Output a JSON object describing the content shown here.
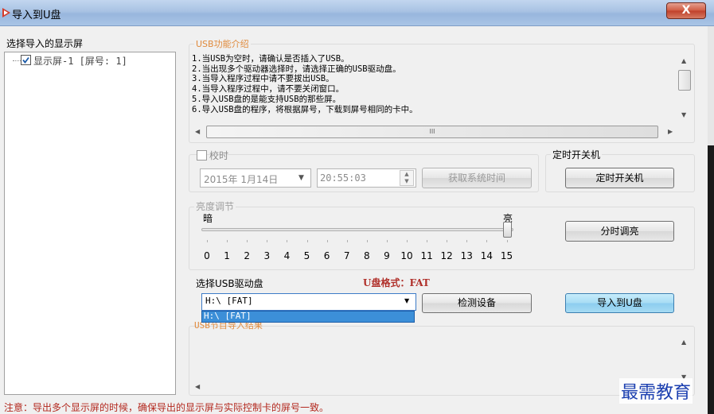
{
  "window": {
    "title": "导入到U盘",
    "close_glyph": "X"
  },
  "left_panel": {
    "caption": "选择导入的显示屏",
    "tree_items": [
      "显示屏-1 [屏号: 1]"
    ],
    "tree_item_checked": true
  },
  "usb_info": {
    "group_title": "USB功能介绍",
    "lines": [
      "1.当USB为空时，请确认是否插入了USB。",
      "2.当出现多个驱动器选择时，请选择正确的USB驱动盘。",
      "3.当导入程序过程中请不要拔出USB。",
      "4.当导入程序过程中，请不要关闭窗口。",
      "5.导入USB盘的是能支持USB的那些屏。",
      "6.导入USB盘的程序，将根据屏号，下载到屏号相同的卡中。"
    ],
    "scroll_thumb_glyph": "III"
  },
  "clock": {
    "checkbox_label": "校时",
    "checked": false,
    "date_value": "2015年 1月14日",
    "time_value": "20:55:03",
    "get_time_button": "获取系统时间"
  },
  "timer": {
    "group_title": "定时开关机",
    "button": "定时开关机"
  },
  "brightness": {
    "group_title": "亮度调节",
    "dark_label": "暗",
    "bright_label": "亮",
    "scale": [
      "0",
      "1",
      "2",
      "3",
      "4",
      "5",
      "6",
      "7",
      "8",
      "9",
      "10",
      "11",
      "12",
      "13",
      "14",
      "15"
    ],
    "value": 15,
    "timed_button": "分时调亮"
  },
  "drive": {
    "caption": "选择USB驱动盘",
    "format_label": "U盘格式：FAT",
    "selected": "H:\\ [FAT]",
    "options": [
      "H:\\ [FAT]"
    ],
    "detect_button": "检测设备",
    "import_button": "导入到U盘"
  },
  "result": {
    "group_title": "USB节目导入结果"
  },
  "footer": {
    "note": "注意：导出多个显示屏的时候，确保导出的显示屏与实际控制卡的屏号一致。"
  },
  "watermark": "最需教育",
  "colors": {
    "group_title": "#e08a3c",
    "note": "#b3281e",
    "format_label": "#b0302a",
    "selection": "#3c8fd8",
    "watermark": "#1b3fb0"
  }
}
